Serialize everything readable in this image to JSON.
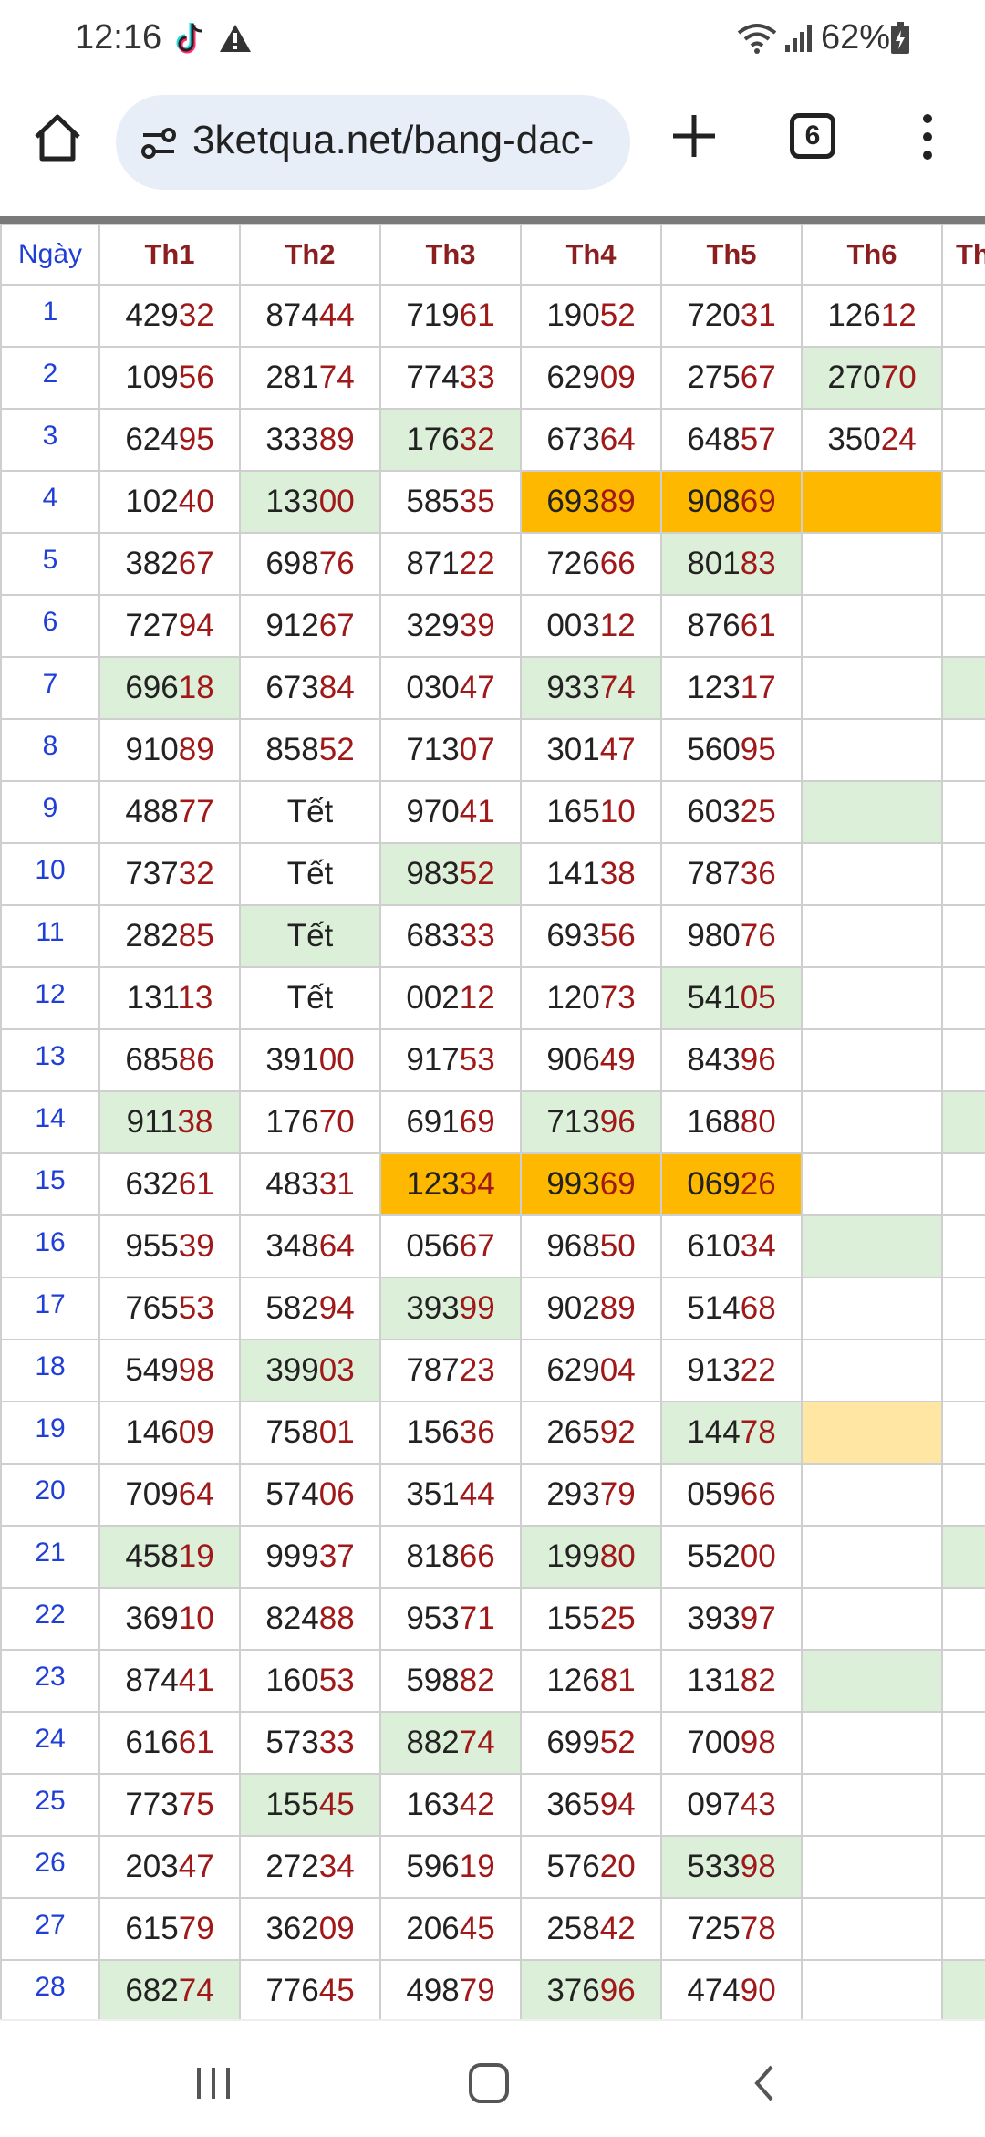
{
  "status_bar": {
    "time": "12:16",
    "battery": "62%",
    "icons": [
      "tiktok-icon",
      "warning-icon",
      "wifi-icon",
      "signal-icon",
      "battery-icon"
    ]
  },
  "browser": {
    "url": "3ketqua.net/bang-dac-",
    "tab_count": "6"
  },
  "table": {
    "headers": [
      "Ngày",
      "Th1",
      "Th2",
      "Th3",
      "Th4",
      "Th5",
      "Th6",
      "Th"
    ],
    "rows": [
      {
        "day": "1",
        "cells": [
          [
            "429",
            "32",
            ""
          ],
          [
            "874",
            "44",
            ""
          ],
          [
            "719",
            "61",
            ""
          ],
          [
            "190",
            "52",
            ""
          ],
          [
            "720",
            "31",
            ""
          ],
          [
            "126",
            "12",
            ""
          ],
          [
            "",
            "",
            ""
          ]
        ]
      },
      {
        "day": "2",
        "cells": [
          [
            "109",
            "56",
            ""
          ],
          [
            "281",
            "74",
            ""
          ],
          [
            "774",
            "33",
            ""
          ],
          [
            "629",
            "09",
            ""
          ],
          [
            "275",
            "67",
            ""
          ],
          [
            "270",
            "70",
            "green"
          ],
          [
            "",
            "",
            ""
          ]
        ]
      },
      {
        "day": "3",
        "cells": [
          [
            "624",
            "95",
            ""
          ],
          [
            "333",
            "89",
            ""
          ],
          [
            "176",
            "32",
            "green"
          ],
          [
            "673",
            "64",
            ""
          ],
          [
            "648",
            "57",
            ""
          ],
          [
            "350",
            "24",
            ""
          ],
          [
            "",
            "",
            ""
          ]
        ]
      },
      {
        "day": "4",
        "cells": [
          [
            "102",
            "40",
            ""
          ],
          [
            "133",
            "00",
            "green"
          ],
          [
            "585",
            "35",
            ""
          ],
          [
            "693",
            "89",
            "orange"
          ],
          [
            "908",
            "69",
            "orange"
          ],
          [
            "",
            "",
            "orange"
          ],
          [
            "",
            "",
            ""
          ]
        ]
      },
      {
        "day": "5",
        "cells": [
          [
            "382",
            "67",
            ""
          ],
          [
            "698",
            "76",
            ""
          ],
          [
            "871",
            "22",
            ""
          ],
          [
            "726",
            "66",
            ""
          ],
          [
            "801",
            "83",
            "green"
          ],
          [
            "",
            "",
            ""
          ],
          [
            "",
            "",
            ""
          ]
        ]
      },
      {
        "day": "6",
        "cells": [
          [
            "727",
            "94",
            ""
          ],
          [
            "912",
            "67",
            ""
          ],
          [
            "329",
            "39",
            ""
          ],
          [
            "003",
            "12",
            ""
          ],
          [
            "876",
            "61",
            ""
          ],
          [
            "",
            "",
            ""
          ],
          [
            "",
            "",
            ""
          ]
        ]
      },
      {
        "day": "7",
        "cells": [
          [
            "696",
            "18",
            "green"
          ],
          [
            "673",
            "84",
            ""
          ],
          [
            "030",
            "47",
            ""
          ],
          [
            "933",
            "74",
            "green"
          ],
          [
            "123",
            "17",
            ""
          ],
          [
            "",
            "",
            ""
          ],
          [
            "",
            "",
            "green"
          ]
        ]
      },
      {
        "day": "8",
        "cells": [
          [
            "910",
            "89",
            ""
          ],
          [
            "858",
            "52",
            ""
          ],
          [
            "713",
            "07",
            ""
          ],
          [
            "301",
            "47",
            ""
          ],
          [
            "560",
            "95",
            ""
          ],
          [
            "",
            "",
            ""
          ],
          [
            "",
            "",
            ""
          ]
        ]
      },
      {
        "day": "9",
        "cells": [
          [
            "488",
            "77",
            ""
          ],
          [
            "Tết",
            "",
            ""
          ],
          [
            "970",
            "41",
            ""
          ],
          [
            "165",
            "10",
            ""
          ],
          [
            "603",
            "25",
            ""
          ],
          [
            "",
            "",
            "green"
          ],
          [
            "",
            "",
            ""
          ]
        ]
      },
      {
        "day": "10",
        "cells": [
          [
            "737",
            "32",
            ""
          ],
          [
            "Tết",
            "",
            ""
          ],
          [
            "983",
            "52",
            "green"
          ],
          [
            "141",
            "38",
            ""
          ],
          [
            "787",
            "36",
            ""
          ],
          [
            "",
            "",
            ""
          ],
          [
            "",
            "",
            ""
          ]
        ]
      },
      {
        "day": "11",
        "cells": [
          [
            "282",
            "85",
            ""
          ],
          [
            "Tết",
            "",
            "green"
          ],
          [
            "683",
            "33",
            ""
          ],
          [
            "693",
            "56",
            ""
          ],
          [
            "980",
            "76",
            ""
          ],
          [
            "",
            "",
            ""
          ],
          [
            "",
            "",
            ""
          ]
        ]
      },
      {
        "day": "12",
        "cells": [
          [
            "131",
            "13",
            ""
          ],
          [
            "Tết",
            "",
            ""
          ],
          [
            "002",
            "12",
            ""
          ],
          [
            "120",
            "73",
            ""
          ],
          [
            "541",
            "05",
            "green"
          ],
          [
            "",
            "",
            ""
          ],
          [
            "",
            "",
            ""
          ]
        ]
      },
      {
        "day": "13",
        "cells": [
          [
            "685",
            "86",
            ""
          ],
          [
            "391",
            "00",
            ""
          ],
          [
            "917",
            "53",
            ""
          ],
          [
            "906",
            "49",
            ""
          ],
          [
            "843",
            "96",
            ""
          ],
          [
            "",
            "",
            ""
          ],
          [
            "",
            "",
            ""
          ]
        ]
      },
      {
        "day": "14",
        "cells": [
          [
            "911",
            "38",
            "green"
          ],
          [
            "176",
            "70",
            ""
          ],
          [
            "691",
            "69",
            ""
          ],
          [
            "713",
            "96",
            "green"
          ],
          [
            "168",
            "80",
            ""
          ],
          [
            "",
            "",
            ""
          ],
          [
            "",
            "",
            "green"
          ]
        ]
      },
      {
        "day": "15",
        "cells": [
          [
            "632",
            "61",
            ""
          ],
          [
            "483",
            "31",
            ""
          ],
          [
            "123",
            "34",
            "orange"
          ],
          [
            "993",
            "69",
            "orange"
          ],
          [
            "069",
            "26",
            "orange"
          ],
          [
            "",
            "",
            ""
          ],
          [
            "",
            "",
            ""
          ]
        ]
      },
      {
        "day": "16",
        "cells": [
          [
            "955",
            "39",
            ""
          ],
          [
            "348",
            "64",
            ""
          ],
          [
            "056",
            "67",
            ""
          ],
          [
            "968",
            "50",
            ""
          ],
          [
            "610",
            "34",
            ""
          ],
          [
            "",
            "",
            "green"
          ],
          [
            "",
            "",
            ""
          ]
        ]
      },
      {
        "day": "17",
        "cells": [
          [
            "765",
            "53",
            ""
          ],
          [
            "582",
            "94",
            ""
          ],
          [
            "393",
            "99",
            "green"
          ],
          [
            "902",
            "89",
            ""
          ],
          [
            "514",
            "68",
            ""
          ],
          [
            "",
            "",
            ""
          ],
          [
            "",
            "",
            ""
          ]
        ]
      },
      {
        "day": "18",
        "cells": [
          [
            "549",
            "98",
            ""
          ],
          [
            "399",
            "03",
            "green"
          ],
          [
            "787",
            "23",
            ""
          ],
          [
            "629",
            "04",
            ""
          ],
          [
            "913",
            "22",
            ""
          ],
          [
            "",
            "",
            ""
          ],
          [
            "",
            "",
            ""
          ]
        ]
      },
      {
        "day": "19",
        "cells": [
          [
            "146",
            "09",
            ""
          ],
          [
            "758",
            "01",
            ""
          ],
          [
            "156",
            "36",
            ""
          ],
          [
            "265",
            "92",
            ""
          ],
          [
            "144",
            "78",
            "green"
          ],
          [
            "",
            "",
            "yellow"
          ],
          [
            "",
            "",
            ""
          ]
        ]
      },
      {
        "day": "20",
        "cells": [
          [
            "709",
            "64",
            ""
          ],
          [
            "574",
            "06",
            ""
          ],
          [
            "351",
            "44",
            ""
          ],
          [
            "293",
            "79",
            ""
          ],
          [
            "059",
            "66",
            ""
          ],
          [
            "",
            "",
            ""
          ],
          [
            "",
            "",
            ""
          ]
        ]
      },
      {
        "day": "21",
        "cells": [
          [
            "458",
            "19",
            "green"
          ],
          [
            "999",
            "37",
            ""
          ],
          [
            "818",
            "66",
            ""
          ],
          [
            "199",
            "80",
            "green"
          ],
          [
            "552",
            "00",
            ""
          ],
          [
            "",
            "",
            ""
          ],
          [
            "",
            "",
            "green"
          ]
        ]
      },
      {
        "day": "22",
        "cells": [
          [
            "369",
            "10",
            ""
          ],
          [
            "824",
            "88",
            ""
          ],
          [
            "953",
            "71",
            ""
          ],
          [
            "155",
            "25",
            ""
          ],
          [
            "393",
            "97",
            ""
          ],
          [
            "",
            "",
            ""
          ],
          [
            "",
            "",
            ""
          ]
        ]
      },
      {
        "day": "23",
        "cells": [
          [
            "874",
            "41",
            ""
          ],
          [
            "160",
            "53",
            ""
          ],
          [
            "598",
            "82",
            ""
          ],
          [
            "126",
            "81",
            ""
          ],
          [
            "131",
            "82",
            ""
          ],
          [
            "",
            "",
            "green"
          ],
          [
            "",
            "",
            ""
          ]
        ]
      },
      {
        "day": "24",
        "cells": [
          [
            "616",
            "61",
            ""
          ],
          [
            "573",
            "33",
            ""
          ],
          [
            "882",
            "74",
            "green"
          ],
          [
            "699",
            "52",
            ""
          ],
          [
            "700",
            "98",
            ""
          ],
          [
            "",
            "",
            ""
          ],
          [
            "",
            "",
            ""
          ]
        ]
      },
      {
        "day": "25",
        "cells": [
          [
            "773",
            "75",
            ""
          ],
          [
            "155",
            "45",
            "green"
          ],
          [
            "163",
            "42",
            ""
          ],
          [
            "365",
            "94",
            ""
          ],
          [
            "097",
            "43",
            ""
          ],
          [
            "",
            "",
            ""
          ],
          [
            "",
            "",
            ""
          ]
        ]
      },
      {
        "day": "26",
        "cells": [
          [
            "203",
            "47",
            ""
          ],
          [
            "272",
            "34",
            ""
          ],
          [
            "596",
            "19",
            ""
          ],
          [
            "576",
            "20",
            ""
          ],
          [
            "533",
            "98",
            "green"
          ],
          [
            "",
            "",
            ""
          ],
          [
            "",
            "",
            ""
          ]
        ]
      },
      {
        "day": "27",
        "cells": [
          [
            "615",
            "79",
            ""
          ],
          [
            "362",
            "09",
            ""
          ],
          [
            "206",
            "45",
            ""
          ],
          [
            "258",
            "42",
            ""
          ],
          [
            "725",
            "78",
            ""
          ],
          [
            "",
            "",
            ""
          ],
          [
            "",
            "",
            ""
          ]
        ]
      },
      {
        "day": "28",
        "cells": [
          [
            "682",
            "74",
            "green"
          ],
          [
            "776",
            "45",
            ""
          ],
          [
            "498",
            "79",
            ""
          ],
          [
            "376",
            "96",
            "green"
          ],
          [
            "474",
            "90",
            ""
          ],
          [
            "",
            "",
            ""
          ],
          [
            "",
            "",
            "green"
          ]
        ]
      }
    ]
  },
  "nav": {
    "icons": [
      "recent-apps-icon",
      "home-icon",
      "back-icon"
    ]
  }
}
